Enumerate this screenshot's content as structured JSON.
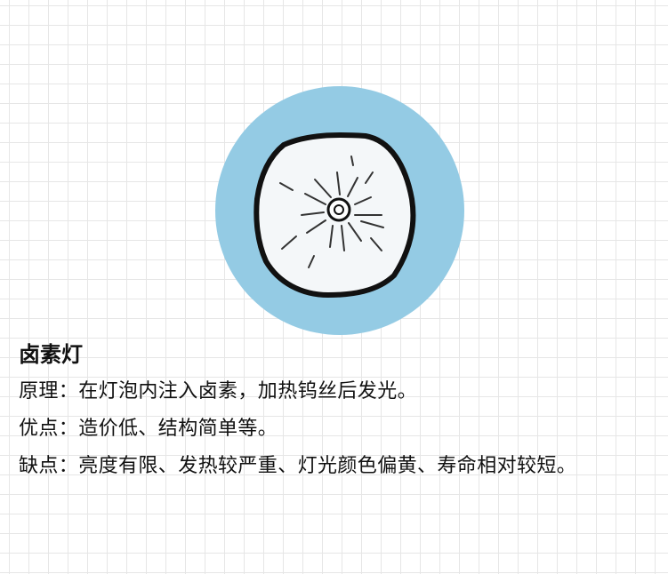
{
  "article": {
    "title": "卤素灯",
    "principle": "原理：在灯泡内注入卤素，加热钨丝后发光。",
    "advantages": "优点：造价低、结构简单等。",
    "disadvantages": "缺点：亮度有限、发热较严重、灯光颜色偏黄、寿命相对较短。"
  },
  "illustration": {
    "icon": "halogen-lamp-icon",
    "circle_color": "#94cbe4",
    "lamp_fill": "#f4f7f9",
    "outline_color": "#111111"
  }
}
